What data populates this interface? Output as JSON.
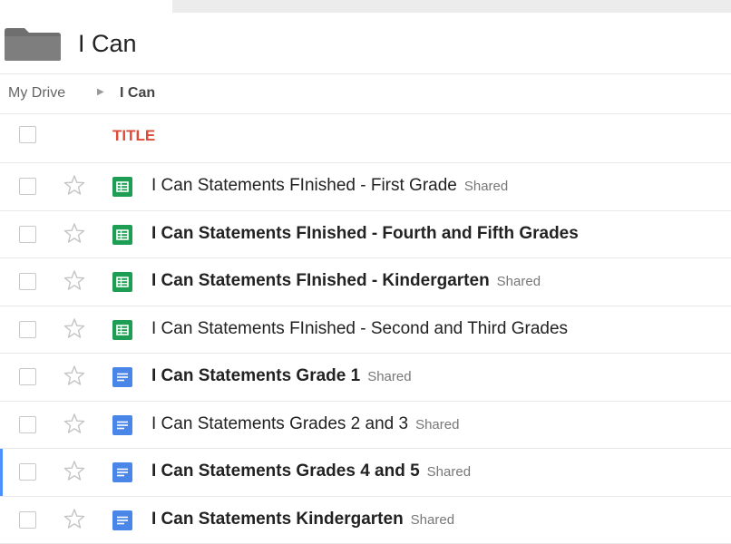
{
  "folder": {
    "title": "I Can",
    "icon": "folder-icon"
  },
  "breadcrumb": {
    "root": "My Drive",
    "separator": "▶",
    "current": "I Can"
  },
  "columns": {
    "title": "TITLE"
  },
  "colors": {
    "accent_red": "#dd4b39",
    "sheet_green": "#1e9e54",
    "doc_blue": "#4a86e8",
    "selected_bar": "#4d90fe"
  },
  "files": [
    {
      "name": "I Can Statements FInished - First Grade",
      "type": "sheet",
      "bold": false,
      "shared": "Shared"
    },
    {
      "name": "I Can Statements FInished - Fourth and Fifth Grades",
      "type": "sheet",
      "bold": true,
      "shared": ""
    },
    {
      "name": "I Can Statements FInished - Kindergarten",
      "type": "sheet",
      "bold": true,
      "shared": "Shared"
    },
    {
      "name": "I Can Statements FInished - Second and Third Grades",
      "type": "sheet",
      "bold": false,
      "shared": ""
    },
    {
      "name": "I Can Statements Grade 1",
      "type": "doc",
      "bold": true,
      "shared": "Shared"
    },
    {
      "name": "I Can Statements Grades 2 and 3",
      "type": "doc",
      "bold": false,
      "shared": "Shared"
    },
    {
      "name": "I Can Statements Grades 4 and 5",
      "type": "doc",
      "bold": true,
      "shared": "Shared",
      "selected": true
    },
    {
      "name": "I Can Statements Kindergarten",
      "type": "doc",
      "bold": true,
      "shared": "Shared"
    }
  ]
}
